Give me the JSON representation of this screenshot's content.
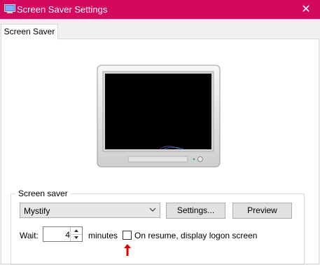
{
  "window": {
    "title": "Screen Saver Settings",
    "close_glyph": "✕",
    "accent": "#d3085e"
  },
  "tabs": [
    {
      "label": "Screen Saver",
      "active": true
    }
  ],
  "preview": {
    "screen_color": "#000000"
  },
  "screensaver_group": {
    "label": "Screen saver",
    "selected": "Mystify",
    "settings_label": "Settings...",
    "preview_label": "Preview",
    "wait_label": "Wait:",
    "wait_value": "4",
    "minutes_label": "minutes",
    "resume_label": "On resume, display logon screen",
    "resume_checked": false
  },
  "annotation": {
    "arrow_color": "#e00000"
  }
}
